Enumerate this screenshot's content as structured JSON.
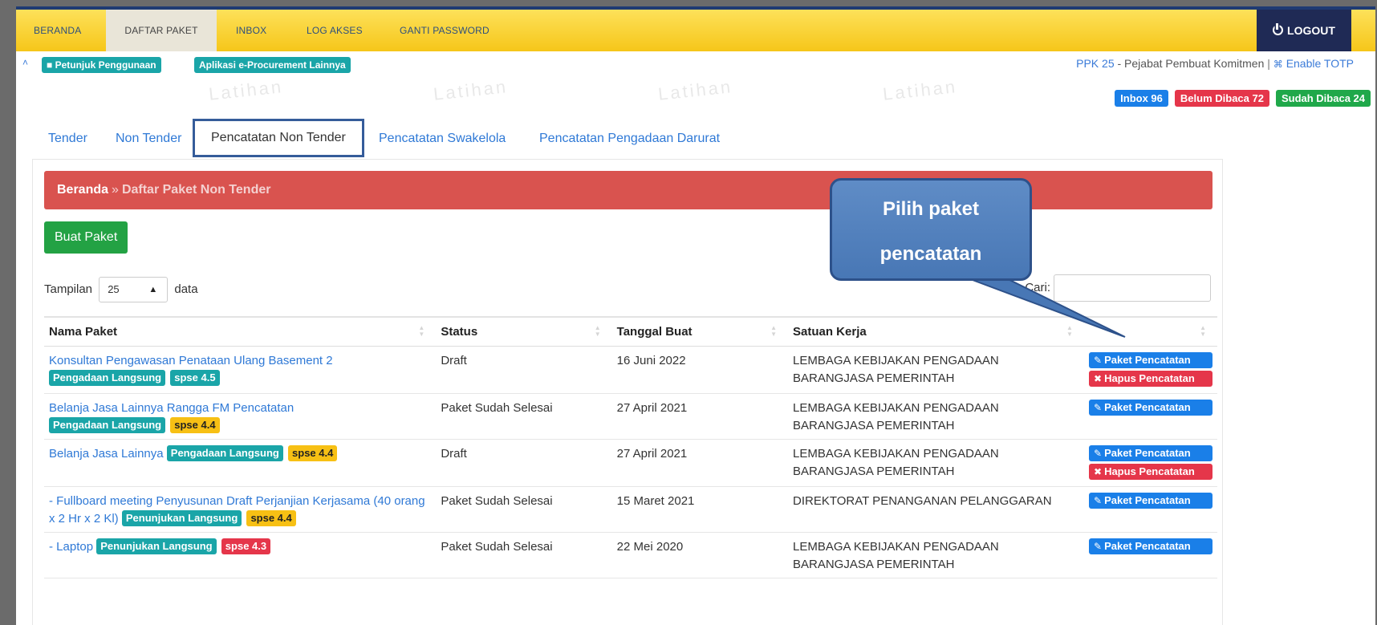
{
  "nav": {
    "items": [
      "BERANDA",
      "DAFTAR PAKET",
      "INBOX",
      "LOG AKSES",
      "GANTI PASSWORD"
    ],
    "logout": "LOGOUT"
  },
  "subbar": {
    "petunjuk": "Petunjuk Penggunaan",
    "aplikasi": "Aplikasi e-Procurement Lainnya",
    "user_code": "PPK 25",
    "user_role": " - Pejabat Pembuat Komitmen",
    "separator": " | ",
    "enable_totp": "Enable TOTP"
  },
  "badges": {
    "inbox": "Inbox 96",
    "belum": "Belum Dibaca 72",
    "sudah": "Sudah Dibaca 24"
  },
  "watermark": "Latihan",
  "tabs": [
    "Tender",
    "Non Tender",
    "Pencatatan Non Tender",
    "Pencatatan Swakelola",
    "Pencatatan Pengadaan Darurat"
  ],
  "breadcrumb": {
    "home": "Beranda",
    "sep": "»",
    "current": "Daftar Paket Non Tender"
  },
  "buat_paket": "Buat Paket",
  "length": {
    "label": "Tampilan",
    "value": "25",
    "suffix": "data"
  },
  "search": {
    "label": "Cari:"
  },
  "table": {
    "headers": [
      "Nama Paket",
      "Status",
      "Tanggal Buat",
      "Satuan Kerja",
      ""
    ],
    "rows": [
      {
        "name": "Konsultan Pengawasan Penataan Ulang Basement 2",
        "method": "Pengadaan Langsung",
        "version": "spse 4.5",
        "status": "Draft",
        "date": "16 Juni 2022",
        "unit": "LEMBAGA KEBIJAKAN PENGADAAN BARANGJASA PEMERINTAH"
      },
      {
        "name": "Belanja Jasa Lainnya Rangga FM Pencatatan",
        "method": "Pengadaan Langsung",
        "version": "spse 4.4",
        "status": "Paket Sudah Selesai",
        "date": "27 April 2021",
        "unit": "LEMBAGA KEBIJAKAN PENGADAAN BARANGJASA PEMERINTAH"
      },
      {
        "name": "Belanja Jasa Lainnya",
        "method": "Pengadaan Langsung",
        "version": "spse 4.4",
        "status": "Draft",
        "date": "27 April 2021",
        "unit": "LEMBAGA KEBIJAKAN PENGADAAN BARANGJASA PEMERINTAH"
      },
      {
        "name": "- Fullboard meeting Penyusunan Draft Perjanjian Kerjasama (40 orang x 2 Hr x 2 Kl)",
        "method": "Penunjukan Langsung",
        "version": "spse 4.4",
        "status": "Paket Sudah Selesai",
        "date": "15 Maret 2021",
        "unit": "DIREKTORAT PENANGANAN PELANGGARAN"
      },
      {
        "name": "- Laptop",
        "method": "Penunjukan Langsung",
        "version": "spse 4.3",
        "status": "Paket Sudah Selesai",
        "date": "22 Mei 2020",
        "unit": "LEMBAGA KEBIJAKAN PENGADAAN BARANGJASA PEMERINTAH"
      }
    ],
    "action_paket": "Paket Pencatatan",
    "action_hapus": "Hapus Pencatatan"
  },
  "callout": {
    "line1": "Pilih paket",
    "line2": "pencatatan"
  },
  "colors": {
    "nav": "#f6c619",
    "logout": "#1f2a55",
    "breadcrumb": "#d9534f",
    "primary": "#1a7fe8",
    "danger": "#e5364a",
    "success": "#23a244",
    "teal": "#1aa5a8",
    "callout": "#4877b5"
  },
  "icons": {
    "logout": "power-icon",
    "petunjuk": "book-icon",
    "totp": "key-icon",
    "paket": "edit-icon",
    "hapus": "trash-icon",
    "collapse": "chevron-up-icon"
  }
}
